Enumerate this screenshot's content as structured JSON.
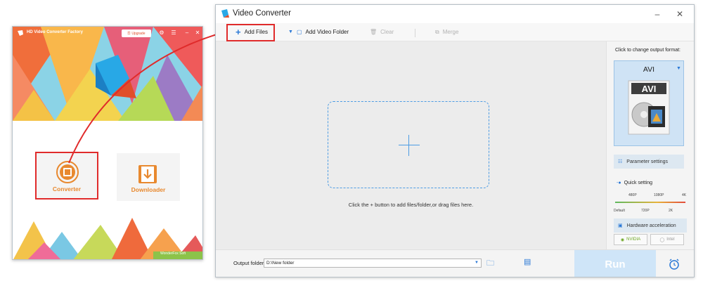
{
  "home_window": {
    "title": "HD Video Converter Factory",
    "upgrade_label": "Upgrade",
    "converter_label": "Converter",
    "downloader_label": "Downloader",
    "brand": "WonderFox Soft"
  },
  "main_window": {
    "title": "Video Converter",
    "toolbar": {
      "add_files": "Add Files",
      "add_video_folder": "Add Video Folder",
      "clear": "Clear",
      "merge": "Merge"
    },
    "drop_hint": "Click the + button to add files/folder,or drag files here.",
    "side_panel": {
      "caption": "Click to change output format:",
      "format": "AVI",
      "parameter_settings": "Parameter settings",
      "quick_setting": "Quick setting",
      "quality_top_ticks": [
        "480P",
        "1080P",
        "4K"
      ],
      "quality_bottom_ticks": [
        "Default",
        "720P",
        "2K"
      ],
      "hardware_acceleration": "Hardware acceleration",
      "nvidia": "NVIDIA",
      "intel": "Intel"
    },
    "bottom": {
      "output_folder_label": "Output folder:",
      "output_folder_value": "D:\\New folder",
      "run_label": "Run"
    }
  },
  "colors": {
    "highlight": "#e02b2b",
    "accent_blue": "#2a78d6",
    "converter_orange": "#e8892f"
  }
}
